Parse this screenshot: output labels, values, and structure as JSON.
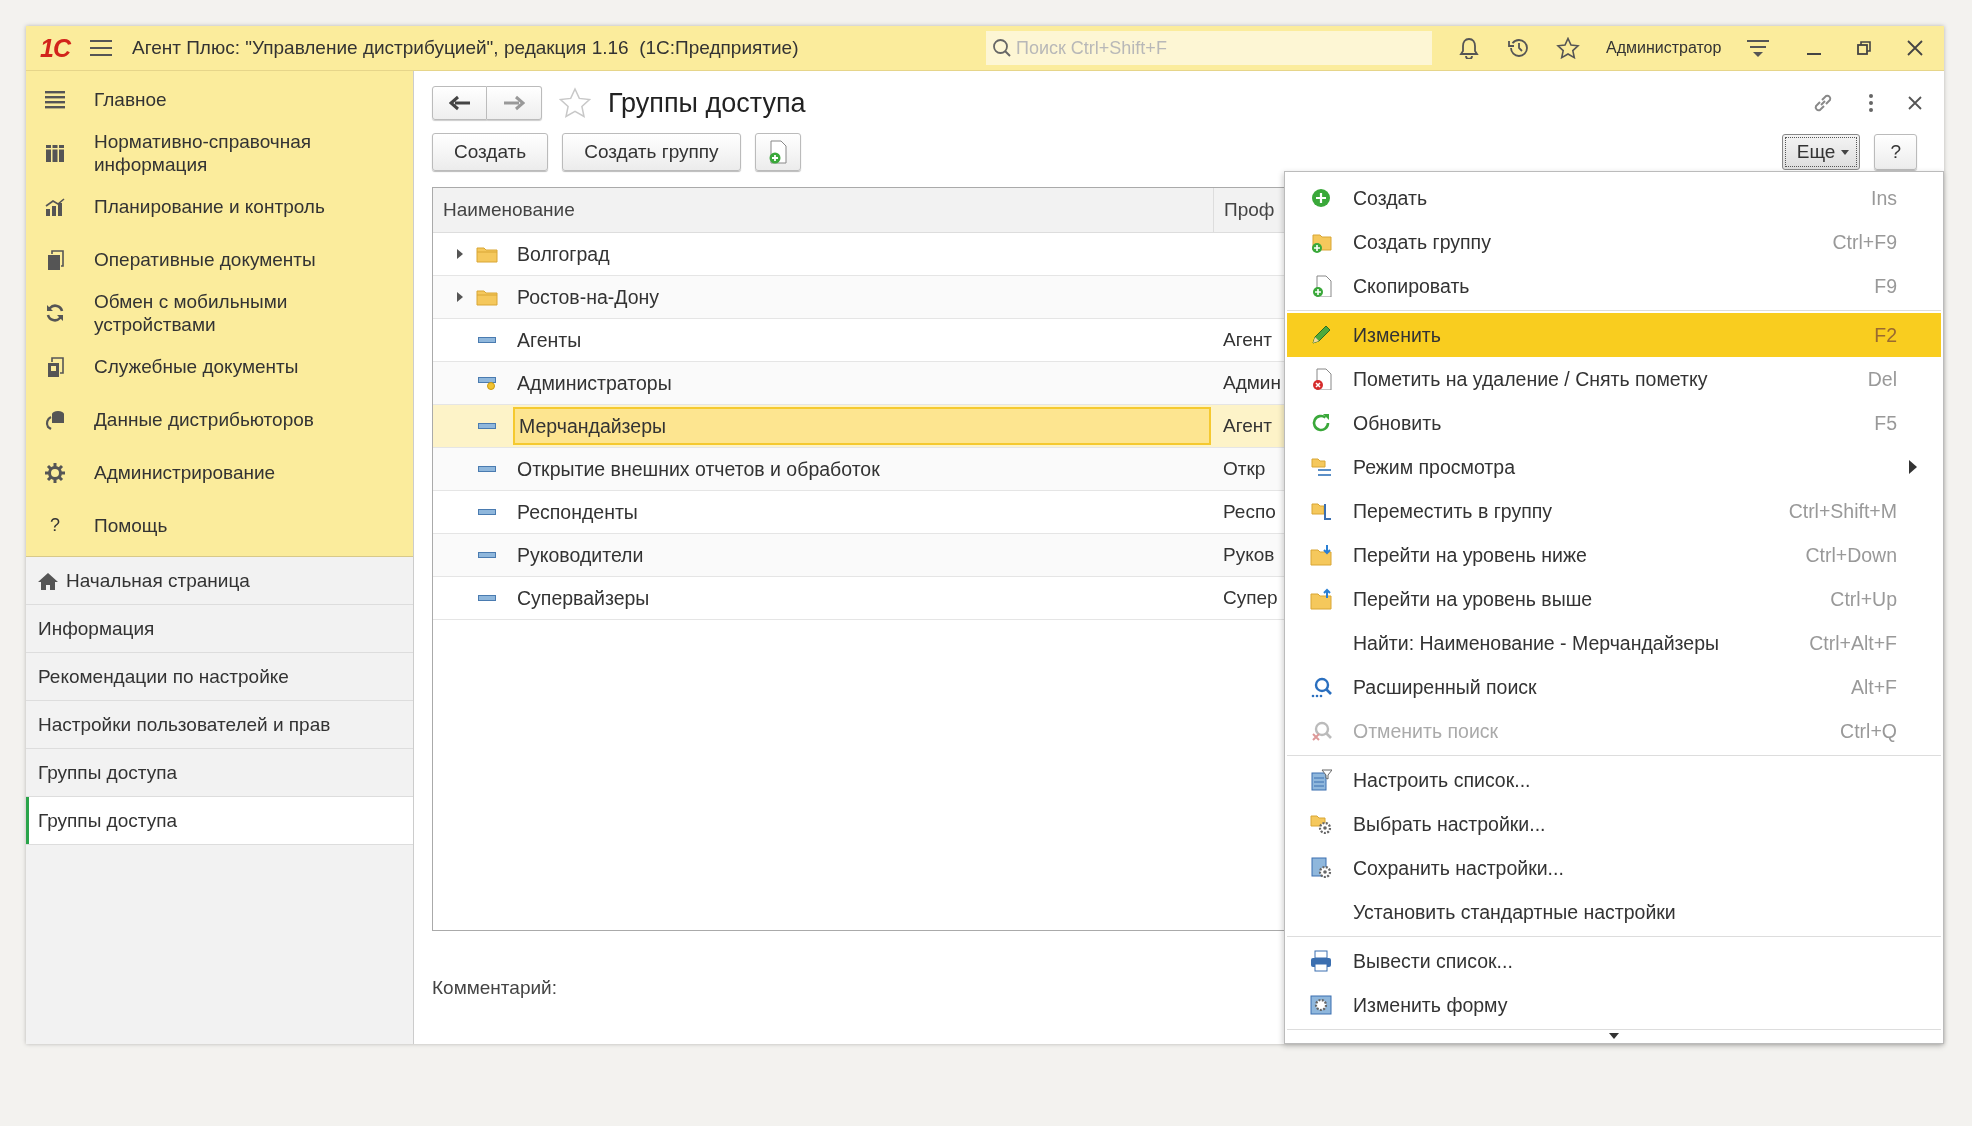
{
  "window": {
    "logo": "1С",
    "title": "Агент Плюс: \"Управление дистрибуцией\", редакция 1.16  (1С:Предприятие)",
    "search": {
      "placeholder": "Поиск Ctrl+Shift+F"
    },
    "user": "Администратор"
  },
  "sections": [
    {
      "label": "Главное"
    },
    {
      "label": "Нормативно-справочная информация"
    },
    {
      "label": "Планирование и контроль"
    },
    {
      "label": "Оперативные документы"
    },
    {
      "label": "Обмен с мобильными устройствами"
    },
    {
      "label": "Служебные документы"
    },
    {
      "label": "Данные дистрибьюторов"
    },
    {
      "label": "Администрирование"
    },
    {
      "label": "Помощь",
      "kind": "help",
      "icon_text": "?"
    }
  ],
  "open_windows": [
    {
      "label": "Начальная страница",
      "kind": "home",
      "selected": false
    },
    {
      "label": "Информация",
      "kind": "page",
      "selected": false
    },
    {
      "label": "Рекомендации по настройке",
      "kind": "page",
      "selected": false
    },
    {
      "label": "Настройки пользователей и прав",
      "kind": "page",
      "selected": false
    },
    {
      "label": "Группы доступа",
      "kind": "page",
      "selected": false
    },
    {
      "label": "Группы доступа",
      "kind": "page",
      "selected": true
    }
  ],
  "form": {
    "title": "Группы доступа",
    "buttons": [
      "Создать",
      "Создать группу"
    ],
    "more_button": "Еще",
    "help_button": "?",
    "table": {
      "columns": [
        "Наименование",
        "Проф"
      ],
      "rows": [
        {
          "kind": "folder",
          "expanded": false,
          "name": "Волгоград",
          "column_2": "",
          "selected": false
        },
        {
          "kind": "folder",
          "expanded": false,
          "name": "Ростов-на-Дону",
          "column_2": "",
          "selected": false
        },
        {
          "kind": "item",
          "name": "Агенты",
          "column_2": "Агент",
          "selected": false
        },
        {
          "kind": "predefined",
          "name": "Администраторы",
          "column_2": "Админ",
          "selected": false
        },
        {
          "kind": "item",
          "name": "Мерчандайзеры",
          "column_2": "Агент",
          "selected": true
        },
        {
          "kind": "item",
          "name": "Открытие внешних отчетов и обработок",
          "column_2": "Откр",
          "selected": false
        },
        {
          "kind": "item",
          "name": "Респонденты",
          "column_2": "Респо",
          "selected": false
        },
        {
          "kind": "item",
          "name": "Руководители",
          "column_2": "Руков",
          "selected": false
        },
        {
          "kind": "item",
          "name": "Супервайзеры",
          "column_2": "Супер",
          "selected": false
        }
      ]
    },
    "comment_label": "Комментарий:"
  },
  "menu": {
    "groups": [
      [
        {
          "label": "Создать",
          "shortcut": "Ins",
          "selected": false,
          "disabled": false
        },
        {
          "label": "Создать группу",
          "shortcut": "Ctrl+F9",
          "selected": false,
          "disabled": false
        },
        {
          "label": "Скопировать",
          "shortcut": "F9",
          "selected": false,
          "disabled": false
        }
      ],
      [
        {
          "label": "Изменить",
          "shortcut": "F2",
          "selected": true,
          "disabled": false
        },
        {
          "label": "Пометить на удаление / Снять пометку",
          "shortcut": "Del",
          "selected": false,
          "disabled": false
        },
        {
          "label": "Обновить",
          "shortcut": "F5",
          "selected": false,
          "disabled": false
        },
        {
          "label": "Режим просмотра",
          "submenu": true,
          "selected": false,
          "disabled": false
        },
        {
          "label": "Переместить в группу",
          "shortcut": "Ctrl+Shift+M",
          "selected": false,
          "disabled": false
        },
        {
          "label": "Перейти на уровень ниже",
          "shortcut": "Ctrl+Down",
          "selected": false,
          "disabled": false
        },
        {
          "label": "Перейти на уровень выше",
          "shortcut": "Ctrl+Up",
          "selected": false,
          "disabled": false
        },
        {
          "label": "Найти: Наименование - Мерчандайзеры",
          "shortcut": "Ctrl+Alt+F",
          "selected": false,
          "disabled": false
        },
        {
          "label": "Расширенный поиск",
          "shortcut": "Alt+F",
          "selected": false,
          "disabled": false
        },
        {
          "label": "Отменить поиск",
          "shortcut": "Ctrl+Q",
          "selected": false,
          "disabled": true
        }
      ],
      [
        {
          "label": "Настроить список...",
          "selected": false,
          "disabled": false
        },
        {
          "label": "Выбрать настройки...",
          "selected": false,
          "disabled": false
        },
        {
          "label": "Сохранить настройки...",
          "selected": false,
          "disabled": false
        },
        {
          "label": "Установить стандартные настройки",
          "selected": false,
          "disabled": false
        }
      ],
      [
        {
          "label": "Вывести список...",
          "selected": false,
          "disabled": false
        },
        {
          "label": "Изменить форму",
          "selected": false,
          "disabled": false
        }
      ]
    ]
  }
}
